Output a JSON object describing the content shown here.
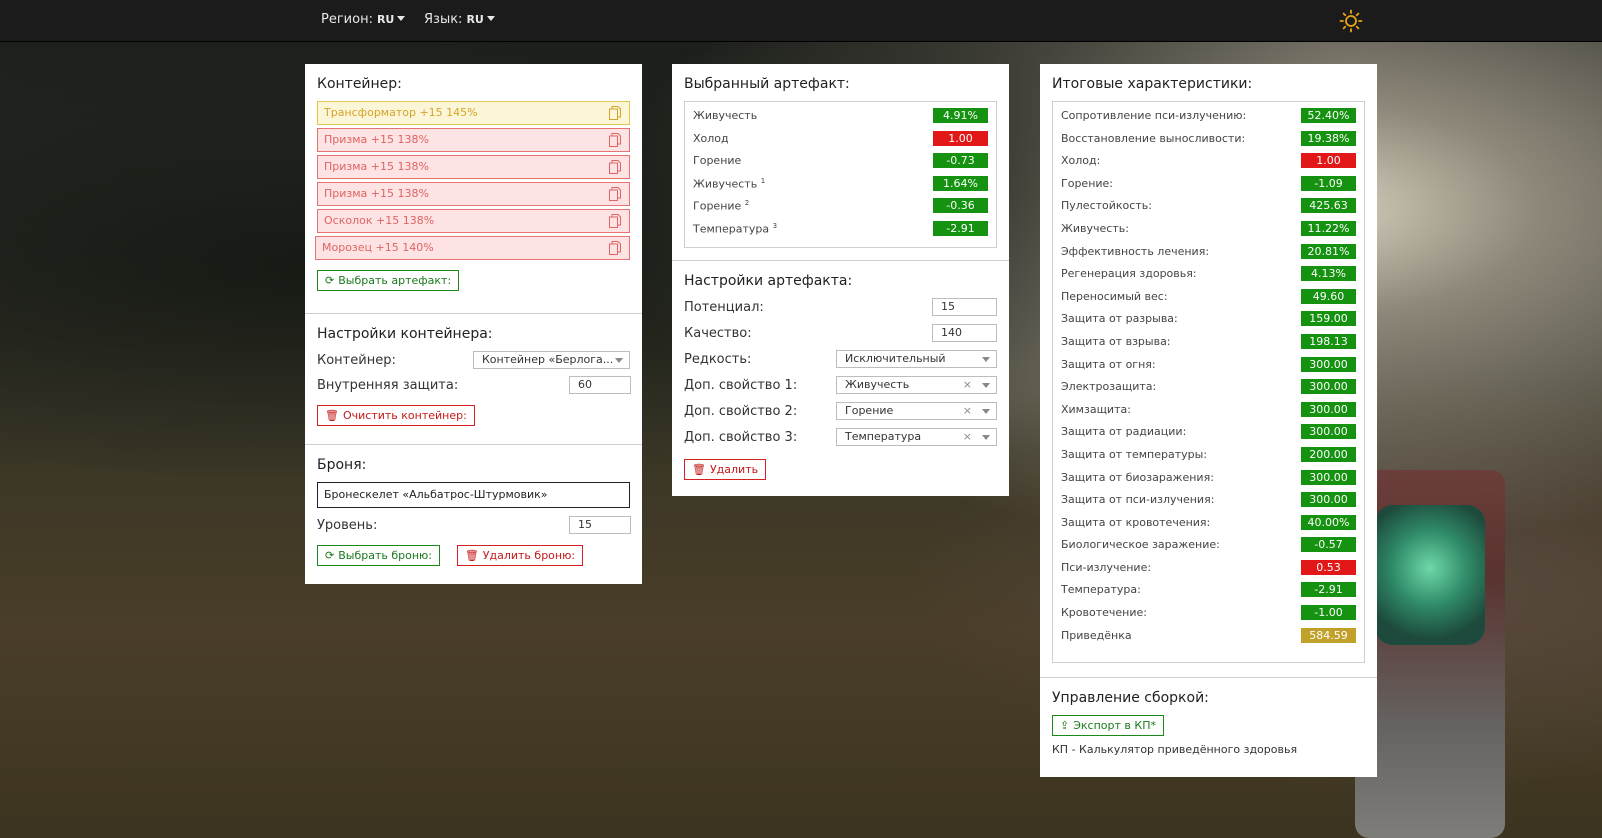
{
  "navbar": {
    "region_label": "Регион:",
    "region_value": "RU",
    "language_label": "Язык:",
    "language_value": "RU",
    "theme_icon": "sun-icon"
  },
  "container_panel": {
    "title": "Контейнер:",
    "slots": [
      {
        "label": "Трансформатор +15 145%",
        "color": "#e5c74d"
      },
      {
        "label": "Призма +15 138%",
        "color": "#e57373"
      },
      {
        "label": "Призма +15 138%",
        "color": "#e57373"
      },
      {
        "label": "Призма +15 138%",
        "color": "#e57373"
      },
      {
        "label": "Осколок +15 138%",
        "color": "#e57373"
      },
      {
        "label": "Морозец +15 140%",
        "color": "#e57373"
      }
    ],
    "choose_artifact_button": "Выбрать артефакт:",
    "settings_title": "Настройки контейнера:",
    "container_label": "Контейнер:",
    "container_value": "Контейнер «Берлога...",
    "inner_protection_label": "Внутренняя защита:",
    "inner_protection_value": "60",
    "clear_button": "Очистить контейнер:",
    "armor_title": "Броня:",
    "armor_value": "Бронескелет «Альбатрос-Штурмовик»",
    "level_label": "Уровень:",
    "level_value": "15",
    "choose_armor_button": "Выбрать броню:",
    "delete_armor_button": "Удалить броню:"
  },
  "artifact_panel": {
    "title": "Выбранный артефакт:",
    "stats": [
      {
        "name": "Живучесть",
        "sup": "",
        "value": "4.91%",
        "color": "green"
      },
      {
        "name": "Холод",
        "sup": "",
        "value": "1.00",
        "color": "red"
      },
      {
        "name": "Горение",
        "sup": "",
        "value": "-0.73",
        "color": "green"
      },
      {
        "name": "Живучесть",
        "sup": "1",
        "value": "1.64%",
        "color": "green"
      },
      {
        "name": "Горение",
        "sup": "2",
        "value": "-0.36",
        "color": "green"
      },
      {
        "name": "Температура",
        "sup": "3",
        "value": "-2.91",
        "color": "green"
      }
    ],
    "settings_title": "Настройки артефакта:",
    "potential_label": "Потенциал:",
    "potential_value": "15",
    "quality_label": "Качество:",
    "quality_value": "140",
    "rarity_label": "Редкость:",
    "rarity_value": "Исключительный",
    "extra1_label": "Доп. свойство 1:",
    "extra1_value": "Живучесть",
    "extra2_label": "Доп. свойство 2:",
    "extra2_value": "Горение",
    "extra3_label": "Доп. свойство 3:",
    "extra3_value": "Температура",
    "clear_symbol": "×",
    "delete_button": "Удалить"
  },
  "totals_panel": {
    "title": "Итоговые характеристики:",
    "stats": [
      {
        "name": "Сопротивление пси-излучению:",
        "value": "52.40%",
        "color": "green"
      },
      {
        "name": "Восстановление выносливости:",
        "value": "19.38%",
        "color": "green"
      },
      {
        "name": "Холод:",
        "value": "1.00",
        "color": "red"
      },
      {
        "name": "Горение:",
        "value": "-1.09",
        "color": "green"
      },
      {
        "name": "Пулестойкость:",
        "value": "425.63",
        "color": "green"
      },
      {
        "name": "Живучесть:",
        "value": "11.22%",
        "color": "green"
      },
      {
        "name": "Эффективность лечения:",
        "value": "20.81%",
        "color": "green"
      },
      {
        "name": "Регенерация здоровья:",
        "value": "4.13%",
        "color": "green"
      },
      {
        "name": "Переносимый вес:",
        "value": "49.60",
        "color": "green"
      },
      {
        "name": "Защита от разрыва:",
        "value": "159.00",
        "color": "green"
      },
      {
        "name": "Защита от взрыва:",
        "value": "198.13",
        "color": "green"
      },
      {
        "name": "Защита от огня:",
        "value": "300.00",
        "color": "green"
      },
      {
        "name": "Электрозащита:",
        "value": "300.00",
        "color": "green"
      },
      {
        "name": "Химзащита:",
        "value": "300.00",
        "color": "green"
      },
      {
        "name": "Защита от радиации:",
        "value": "300.00",
        "color": "green"
      },
      {
        "name": "Защита от температуры:",
        "value": "200.00",
        "color": "green"
      },
      {
        "name": "Защита от биозаражения:",
        "value": "300.00",
        "color": "green"
      },
      {
        "name": "Защита от пси-излучения:",
        "value": "300.00",
        "color": "green"
      },
      {
        "name": "Защита от кровотечения:",
        "value": "40.00%",
        "color": "green"
      },
      {
        "name": "Биологическое заражение:",
        "value": "-0.57",
        "color": "green"
      },
      {
        "name": "Пси-излучение:",
        "value": "0.53",
        "color": "red"
      },
      {
        "name": "Температура:",
        "value": "-2.91",
        "color": "green"
      },
      {
        "name": "Кровотечение:",
        "value": "-1.00",
        "color": "green"
      },
      {
        "name": "Приведёнка",
        "value": "584.59",
        "color": "gold"
      }
    ],
    "build_title": "Управление сборкой:",
    "export_button": "Экспорт в КП*",
    "footnote": "КП - Калькулятор приведённого здоровья"
  },
  "colors": {
    "green": "#15920f",
    "red": "#e21818",
    "gold": "#c2a12a"
  }
}
